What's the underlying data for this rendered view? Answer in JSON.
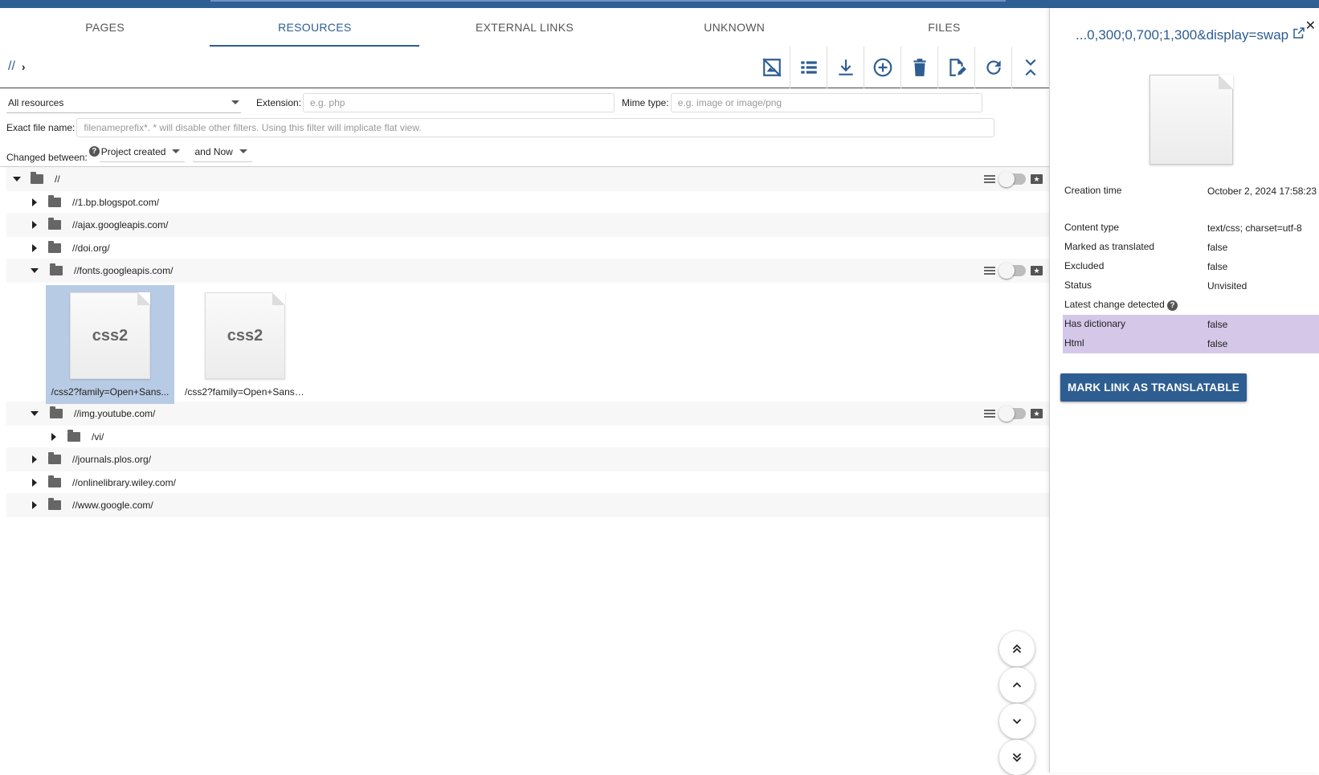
{
  "tabs": [
    {
      "label": "PAGES",
      "active": false
    },
    {
      "label": "RESOURCES",
      "active": true
    },
    {
      "label": "EXTERNAL LINKS",
      "active": false
    },
    {
      "label": "UNKNOWN",
      "active": false
    },
    {
      "label": "FILES",
      "active": false
    }
  ],
  "breadcrumb": {
    "root": "//",
    "chevron": "›"
  },
  "toolbar_icons": [
    "no-image-icon",
    "list-view-icon",
    "download-icon",
    "add-circle-icon",
    "delete-icon",
    "edit-document-icon",
    "refresh-icon",
    "collapse-icon"
  ],
  "filters": {
    "resource_select": "All resources",
    "extension_label": "Extension:",
    "extension_placeholder": "e.g. php",
    "mime_label": "Mime type:",
    "mime_placeholder": "e.g. image or image/png",
    "exact_label": "Exact file name:",
    "exact_placeholder": "filenameprefix*. * will disable other filters. Using this filter will implicate flat view.",
    "changed_label": "Changed between:",
    "changed_from": "Project created",
    "changed_to": "and Now"
  },
  "tree": {
    "root": "//",
    "items": [
      {
        "label": "//1.bp.blogspot.com/"
      },
      {
        "label": "//ajax.googleapis.com/"
      },
      {
        "label": "//doi.org/"
      },
      {
        "label": "//fonts.googleapis.com/"
      },
      {
        "label": "//img.youtube.com/"
      },
      {
        "label": "/vi/"
      },
      {
        "label": "//journals.plos.org/"
      },
      {
        "label": "//onlinelibrary.wiley.com/"
      },
      {
        "label": "//www.google.com/"
      }
    ],
    "files": [
      {
        "thumb": "css2",
        "name": "/css2?family=Open+Sans...",
        "selected": true
      },
      {
        "thumb": "css2",
        "name": "/css2?family=Open+Sans:...",
        "selected": false
      }
    ]
  },
  "side": {
    "title": "...0,300;0,700;1,300&display=swap",
    "properties": [
      {
        "key": "Creation time",
        "value": "October 2, 2024 17:58:23"
      },
      {
        "key": "Content type",
        "value": "text/css; charset=utf-8"
      },
      {
        "key": "Marked as translated",
        "value": "false"
      },
      {
        "key": "Excluded",
        "value": "false"
      },
      {
        "key": "Status",
        "value": "Unvisited"
      },
      {
        "key": "Latest change detected",
        "value": ""
      },
      {
        "key": "Has dictionary",
        "value": "false"
      },
      {
        "key": "Html",
        "value": "false"
      }
    ],
    "button": "MARK LINK AS TRANSLATABLE"
  },
  "colors": {
    "accent": "#2e5d91",
    "highlight": "#d4c7e8",
    "selected_file": "#b8cbe4"
  }
}
